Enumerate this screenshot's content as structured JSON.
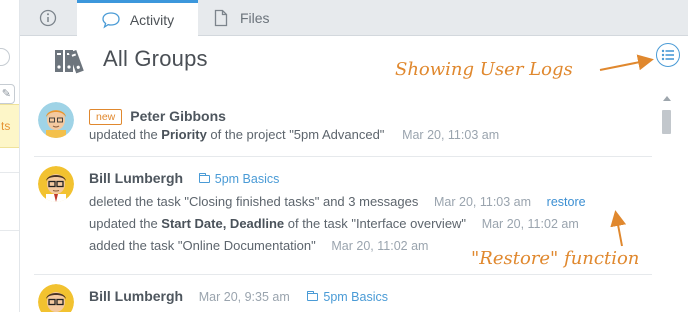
{
  "tabs": {
    "activity_label": "Activity",
    "files_label": "Files"
  },
  "header": {
    "title": "All Groups"
  },
  "feed": [
    {
      "badge": "new",
      "author": "Peter Gibbons",
      "lines": [
        {
          "pre": "updated the ",
          "bold": "Priority",
          "post": " of the project \"5pm Advanced\"",
          "time": "Mar 20, 11:03 am"
        }
      ]
    },
    {
      "author": "Bill Lumbergh",
      "project": "5pm Basics",
      "lines": [
        {
          "text": "deleted the task \"Closing finished tasks\" and 3 messages",
          "time": "Mar 20, 11:03 am",
          "action": "restore"
        },
        {
          "pre": "updated the ",
          "bold": "Start Date, Deadline",
          "post": " of the task \"Interface overview\"",
          "time": "Mar 20, 11:02 am"
        },
        {
          "text": "added the task \"Online Documentation\"",
          "time": "Mar 20, 11:02 am"
        }
      ]
    },
    {
      "author": "Bill Lumbergh",
      "time": "Mar 20, 9:35 am",
      "project": "5pm Basics"
    }
  ],
  "annotations": {
    "logs": "Showing User Logs",
    "restore": "\"Restore\" function"
  },
  "left_panel": {
    "note_text": "ts"
  },
  "colors": {
    "accent": "#3c97dc",
    "annotation": "#e0882e",
    "badge": "#e0882e",
    "tab_bar": "#e7eaed"
  }
}
